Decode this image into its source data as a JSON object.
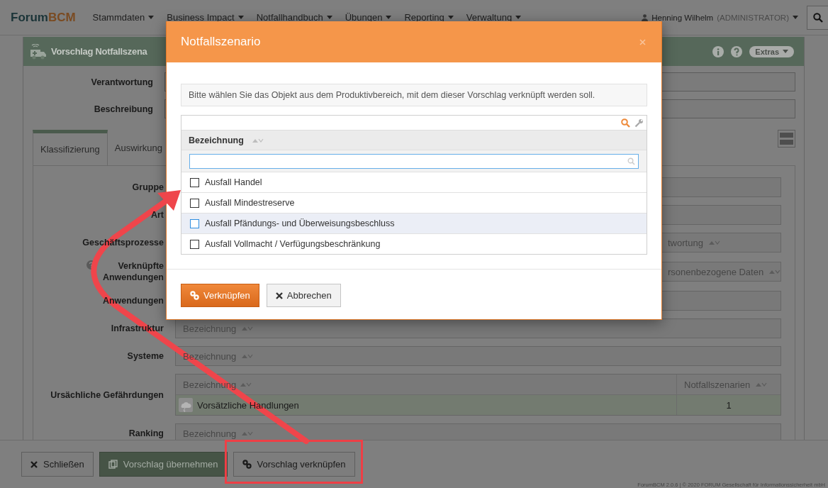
{
  "navbar": {
    "logo_part_1": "Forum",
    "logo_part_2": "BCM",
    "menu": [
      {
        "label": "Stammdaten"
      },
      {
        "label": "Business Impact"
      },
      {
        "label": "Notfallhandbuch"
      },
      {
        "label": "Übungen"
      },
      {
        "label": "Reporting"
      },
      {
        "label": "Verwaltung"
      }
    ],
    "user": {
      "name": "Henning Wilhelm",
      "role": "(ADMINISTRATOR)"
    }
  },
  "page": {
    "title": "Vorschlag Notfallszena",
    "extras": "Extras",
    "fields": [
      {
        "label": "Verantwortung"
      },
      {
        "label": "Beschreibung"
      }
    ],
    "tabs": [
      {
        "label": "Klassifizierung",
        "selected": true
      },
      {
        "label": "Auswirkung",
        "selected": false
      }
    ],
    "rows": [
      {
        "kind": "input",
        "label": "Gruppe"
      },
      {
        "kind": "input",
        "label": "Art"
      },
      {
        "kind": "covered",
        "label": "Geschäftsprozesse",
        "column": "twortung"
      },
      {
        "kind": "covered",
        "label": "Verknüpfte Anwendungen",
        "help": true,
        "column": "rsonenbezogene Daten"
      },
      {
        "kind": "input",
        "label": "Anwendungen"
      },
      {
        "kind": "table",
        "label": "Infrastruktur",
        "column": "Bezeichnung"
      },
      {
        "kind": "table",
        "label": "Systeme",
        "column": "Bezeichnung"
      },
      {
        "kind": "grid",
        "label": "Ursächliche Gefährdungen",
        "columns": [
          "Bezeichnung",
          "Notfallszenarien"
        ],
        "items": [
          {
            "name": "Vorsätzliche Handlungen",
            "count": "1"
          }
        ]
      },
      {
        "kind": "table",
        "label": "Ranking",
        "column": "Bezeichnung"
      }
    ]
  },
  "footer_buttons": [
    {
      "kind": "close",
      "label": "Schließen"
    },
    {
      "kind": "adopt",
      "label": "Vorschlag übernehmen"
    },
    {
      "kind": "link",
      "label": "Vorschlag verknüpfen"
    }
  ],
  "copyright": "ForumBCM 2.0.6 | © 2020 FORUM Gesellschaft für Informationssicherheit mbH",
  "modal": {
    "title": "Notfallszenario",
    "info": "Bitte wählen Sie das Objekt aus dem Produktivbereich, mit dem dieser Vorschlag verknüpft werden soll.",
    "column": "Bezeichnung",
    "items": [
      {
        "label": "Ausfall Handel",
        "checked": false,
        "highlighted": false
      },
      {
        "label": "Ausfall Mindestreserve",
        "checked": false,
        "highlighted": false
      },
      {
        "label": "Ausfall Pfändungs- und Überweisungsbeschluss",
        "checked": false,
        "highlighted": true
      },
      {
        "label": "Ausfall Vollmacht / Verfügungsbeschränkung",
        "checked": false,
        "highlighted": false
      }
    ],
    "buttons": [
      {
        "kind": "primary",
        "label": "Verknüpfen"
      },
      {
        "kind": "cancel",
        "label": "Abbrechen"
      }
    ]
  }
}
